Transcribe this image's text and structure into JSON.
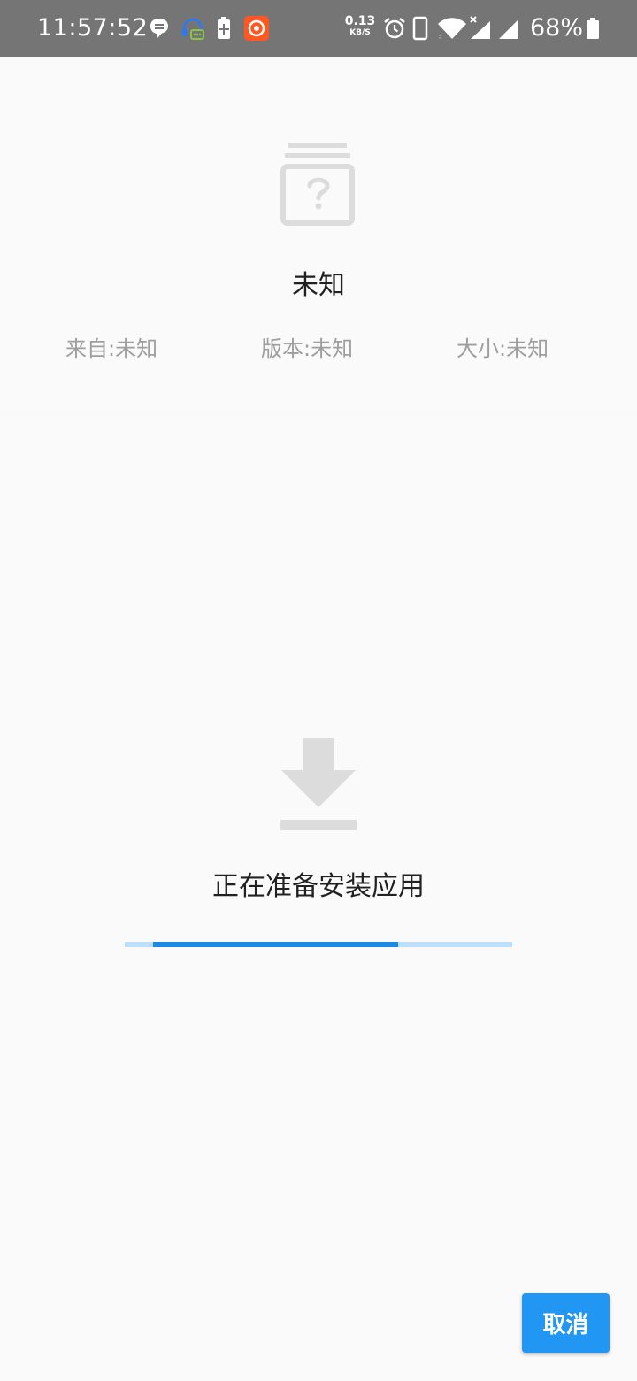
{
  "status_bar": {
    "time": "11:57:52",
    "net_speed_value": "0.13",
    "net_speed_unit": "KB/S",
    "battery_percent": "68%",
    "icons": [
      "chat-bubble-icon",
      "headset-chat-icon",
      "battery-plus-icon",
      "orange-app-icon",
      "alarm-icon",
      "phone-icon",
      "wifi-icon",
      "signal-x-icon",
      "signal-icon",
      "battery-icon"
    ]
  },
  "app": {
    "name": "未知",
    "icon": "unknown-app-icon",
    "source_label": "来自:未知",
    "version_label": "版本:未知",
    "size_label": "大小:未知"
  },
  "progress": {
    "icon": "download-icon",
    "status_text": "正在准备安装应用",
    "fill_start_fraction": 0.073,
    "fill_end_fraction": 0.705
  },
  "actions": {
    "cancel_label": "取消"
  },
  "colors": {
    "status_bar": "#757575",
    "accent": "#2196f3",
    "progress_fill": "#1e88e5",
    "progress_track": "#bbdefb",
    "icon_gray": "#dcdcdc"
  }
}
